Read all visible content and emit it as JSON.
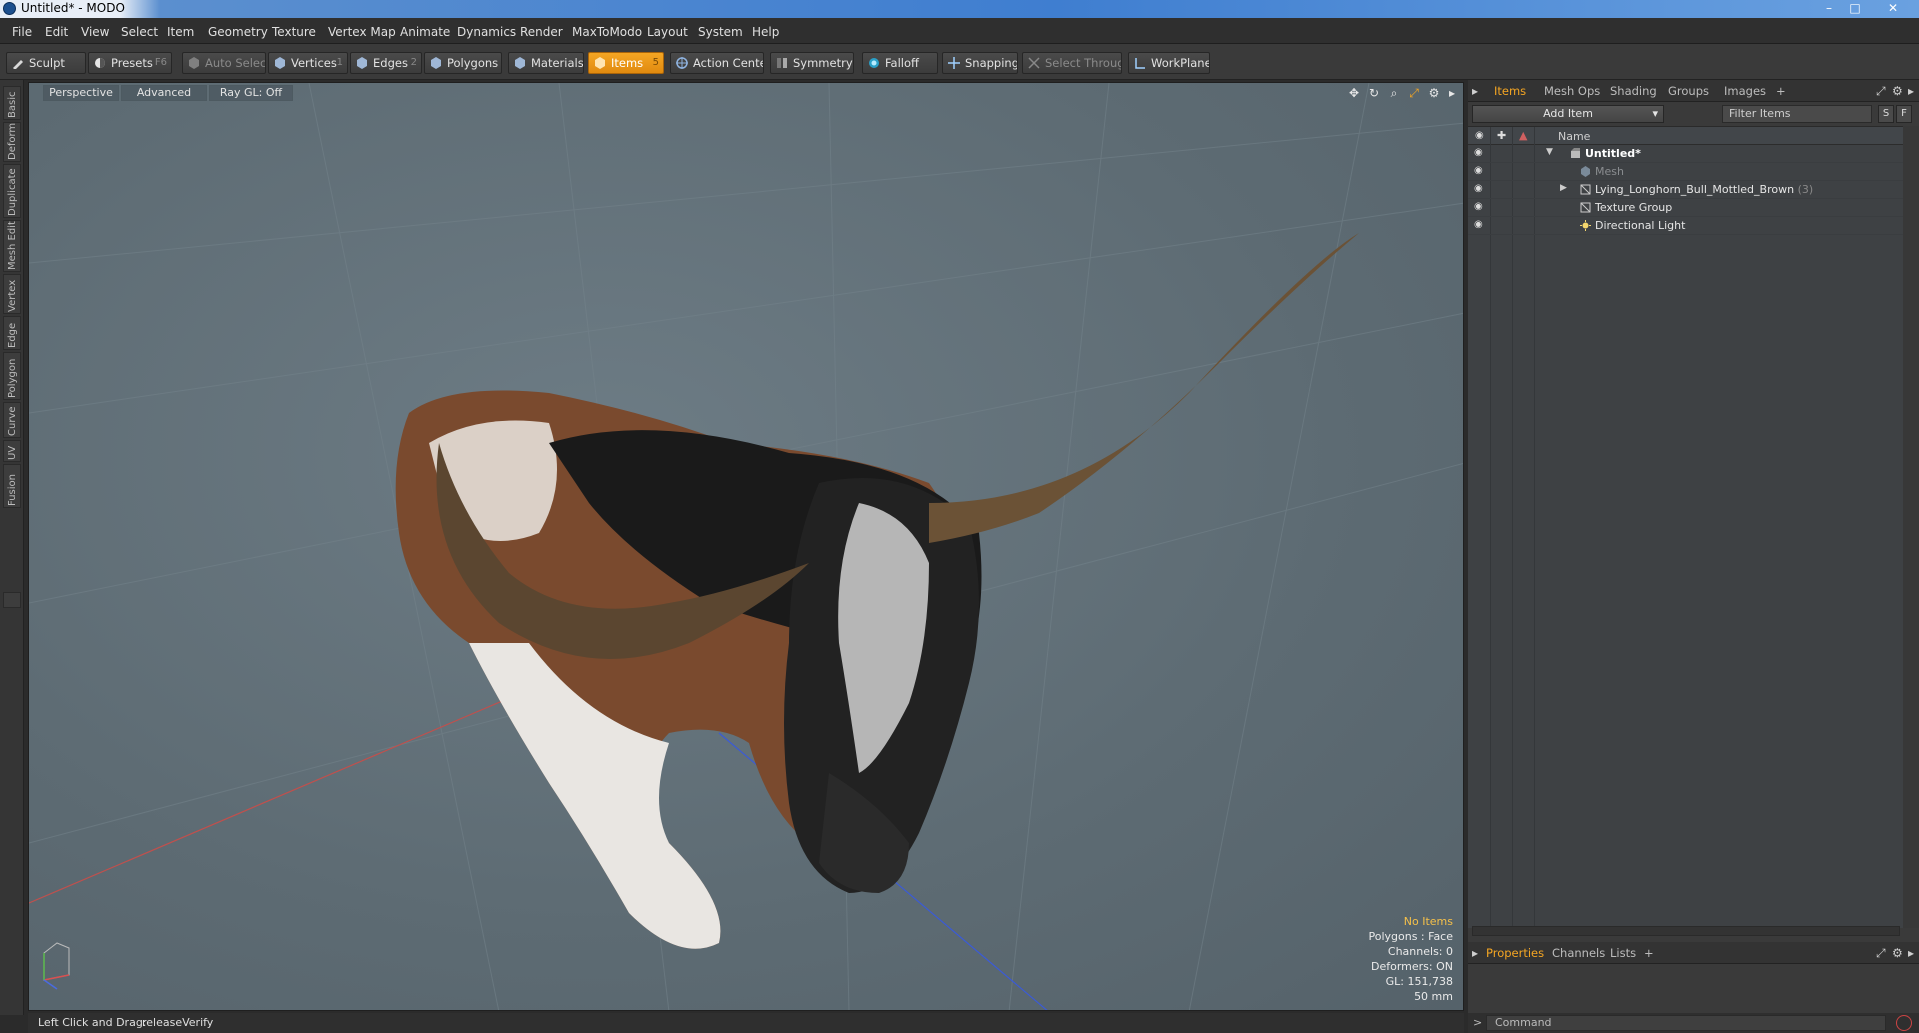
{
  "window": {
    "title": "Untitled* - MODO",
    "minimize": "–",
    "maximize": "□",
    "close": "✕"
  },
  "menubar": [
    "File",
    "Edit",
    "View",
    "Select",
    "Item",
    "Geometry",
    "Texture",
    "Vertex Map",
    "Animate",
    "Dynamics",
    "Render",
    "MaxToModo",
    "Layout",
    "System",
    "Help"
  ],
  "toolbar": {
    "sculpt": "Sculpt",
    "presets": "Presets",
    "presets_key": "F6",
    "auto_select": "Auto Select",
    "vertices": "Vertices",
    "vertices_key": "1",
    "edges": "Edges",
    "edges_key": "2",
    "polygons": "Polygons",
    "materials": "Materials",
    "items": "Items",
    "items_key": "5",
    "action_center": "Action Center",
    "symmetry": "Symmetry",
    "falloff": "Falloff",
    "snapping": "Snapping",
    "select_through": "Select Through",
    "workplane": "WorkPlane"
  },
  "left_tabs": [
    "Basic",
    "Deform",
    "Duplicate",
    "Mesh Edit",
    "Vertex",
    "Edge",
    "Polygon",
    "Curve",
    "UV",
    "Fusion"
  ],
  "viewport": {
    "tabs": [
      "Perspective",
      "Advanced",
      "Ray GL: Off"
    ],
    "info": {
      "no_items": "No Items",
      "polygons": "Polygons : Face",
      "channels": "Channels: 0",
      "deformers": "Deformers: ON",
      "gl": "GL: 151,738",
      "scale": "50 mm"
    }
  },
  "right_panel": {
    "tabs": [
      "Items",
      "Mesh Ops",
      "Shading",
      "Groups",
      "Images"
    ],
    "add_tab": "+",
    "add_item": "Add Item",
    "filter_items": "Filter Items",
    "s_btn": "S",
    "f_btn": "F",
    "column_name": "Name",
    "tree": [
      {
        "label": "Untitled*",
        "style": "bold"
      },
      {
        "label": "Mesh",
        "style": "dim"
      },
      {
        "label": "Lying_Longhorn_Bull_Mottled_Brown",
        "count": "(3)",
        "style": "normal"
      },
      {
        "label": "Texture Group",
        "style": "normal"
      },
      {
        "label": "Directional Light",
        "style": "normal"
      }
    ],
    "bottom_tabs": [
      "Properties",
      "Channels",
      "Lists"
    ],
    "bottom_add": "+"
  },
  "status": {
    "action": "Left Click and Drag:",
    "command_name": "releaseVerify"
  },
  "command": {
    "prompt": ">",
    "placeholder": "Command"
  },
  "colors": {
    "accent": "#f5a623",
    "viewport_bg": "#5f6d75",
    "panel_bg": "#3a3a3a",
    "x_axis": "#c0504d",
    "z_axis": "#3b5bd6"
  }
}
